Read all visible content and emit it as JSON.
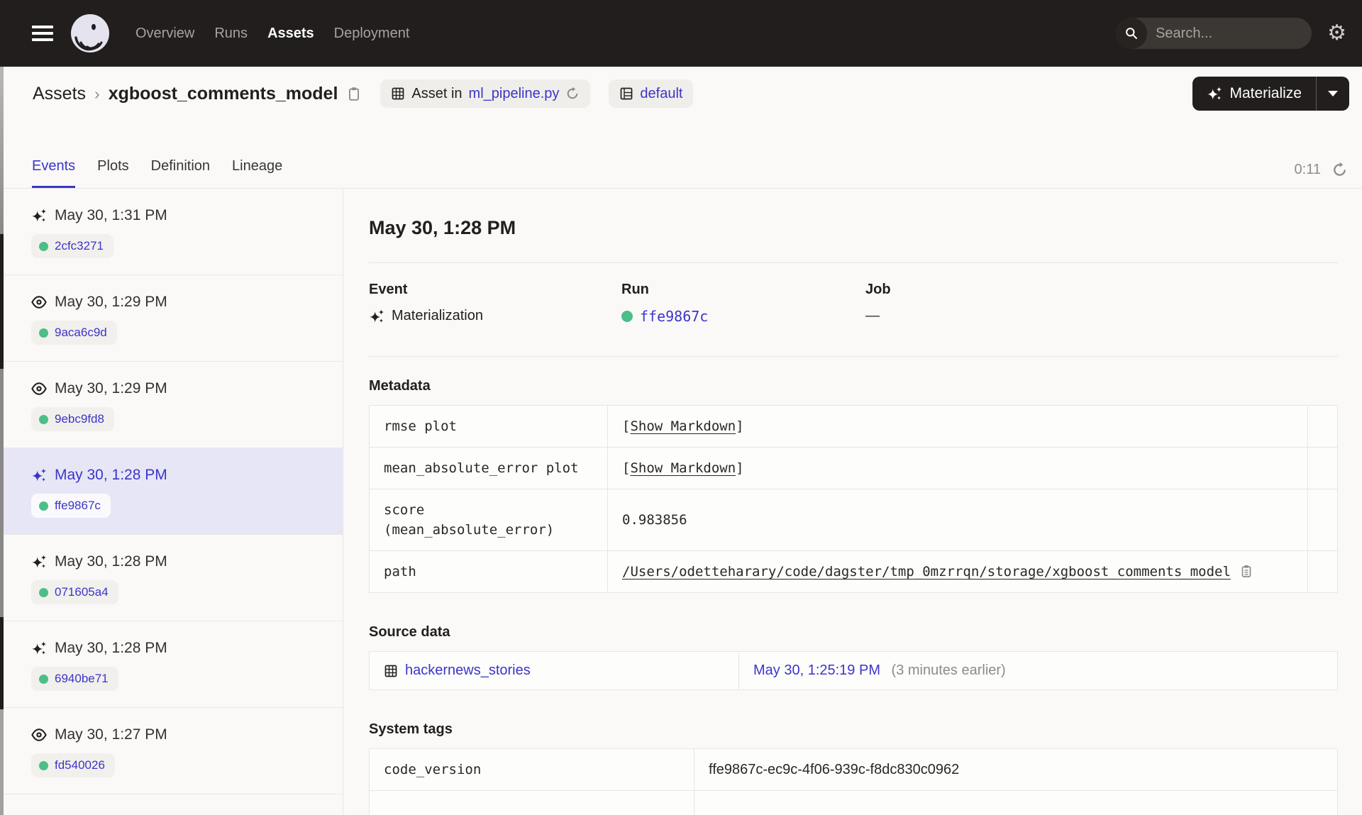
{
  "colors": {
    "header_bg": "#211E1D",
    "page_bg": "#FAF9F7",
    "accent_indigo": "#3C35C9",
    "success_green": "#4CBE88",
    "selected_row_bg": "#E7E6F7",
    "border": "#E8E6E2"
  },
  "icons": [
    "hamburger-icon",
    "dagster-logo",
    "search-icon",
    "gear-icon",
    "clipboard-copy-icon",
    "asset-grid-icon",
    "refresh-icon",
    "repo-icon",
    "sparkle-materialize-icon",
    "eye-observation-icon",
    "caret-down-icon",
    "run-status-dot"
  ],
  "topnav": {
    "nav_items": [
      {
        "label": "Overview"
      },
      {
        "label": "Runs"
      },
      {
        "label": "Assets"
      },
      {
        "label": "Deployment"
      }
    ],
    "search_placeholder": "Search...",
    "search_shortcut": "/"
  },
  "breadcrumb": {
    "root": "Assets",
    "separator": "›",
    "current": "xgboost_comments_model",
    "asset_location_prefix": "Asset in",
    "asset_location_file": "ml_pipeline.py",
    "repo_tag": "default",
    "materialize_label": "Materialize"
  },
  "tabs": {
    "items": [
      {
        "label": "Events"
      },
      {
        "label": "Plots"
      },
      {
        "label": "Definition"
      },
      {
        "label": "Lineage"
      }
    ],
    "refresh_timer": "0:11"
  },
  "sidebar": {
    "events": [
      {
        "type": "materialization",
        "icon": "sparkle-icon",
        "time": "May 30, 1:31 PM",
        "run_id": "2cfc3271",
        "selected": false
      },
      {
        "type": "observation",
        "icon": "eye-icon",
        "time": "May 30, 1:29 PM",
        "run_id": "9aca6c9d",
        "selected": false
      },
      {
        "type": "observation",
        "icon": "eye-icon",
        "time": "May 30, 1:29 PM",
        "run_id": "9ebc9fd8",
        "selected": false
      },
      {
        "type": "materialization",
        "icon": "sparkle-icon",
        "time": "May 30, 1:28 PM",
        "run_id": "ffe9867c",
        "selected": true
      },
      {
        "type": "materialization",
        "icon": "sparkle-icon",
        "time": "May 30, 1:28 PM",
        "run_id": "071605a4",
        "selected": false
      },
      {
        "type": "materialization",
        "icon": "sparkle-icon",
        "time": "May 30, 1:28 PM",
        "run_id": "6940be71",
        "selected": false
      },
      {
        "type": "observation",
        "icon": "eye-icon",
        "time": "May 30, 1:27 PM",
        "run_id": "fd540026",
        "selected": false
      }
    ]
  },
  "detail": {
    "title": "May 30, 1:28 PM",
    "event": {
      "label": "Event",
      "value": "Materialization"
    },
    "run": {
      "label": "Run",
      "value": "ffe9867c"
    },
    "job": {
      "label": "Job",
      "value": "—"
    },
    "metadata": {
      "heading": "Metadata",
      "bracket_open": "[",
      "bracket_close": "]",
      "rows": [
        {
          "key": "rmse plot",
          "value_label": "Show Markdown"
        },
        {
          "key": "mean_absolute_error plot",
          "value_label": "Show Markdown"
        },
        {
          "key": "score (mean_absolute_error)",
          "value": "0.983856"
        },
        {
          "key": "path",
          "value": "/Users/odetteharary/code/dagster/tmp_0mzrrqn/storage/xgboost_comments_model"
        }
      ]
    },
    "source_data": {
      "heading": "Source data",
      "asset": "hackernews_stories",
      "timestamp": "May 30, 1:25:19 PM",
      "relative": "(3 minutes earlier)"
    },
    "system_tags": {
      "heading": "System tags",
      "rows": [
        {
          "key": "code_version",
          "value": "ffe9867c-ec9c-4f06-939c-f8dc830c0962"
        }
      ]
    }
  }
}
